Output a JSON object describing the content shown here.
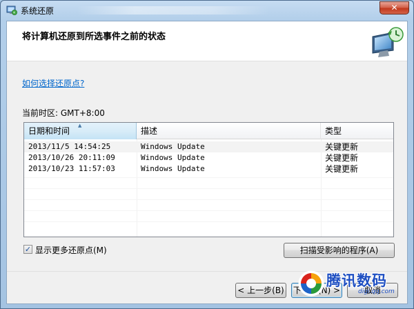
{
  "window": {
    "title": "系统还原",
    "close_label": "✕",
    "accent_close": "#c2391d"
  },
  "header": {
    "title": "将计算机还原到所选事件之前的状态",
    "art_icon": "system-restore-monitor-icon"
  },
  "help_link": "如何选择还原点?",
  "timezone_label": "当前时区: GMT+8:00",
  "table": {
    "columns": [
      "日期和时间",
      "描述",
      "类型"
    ],
    "sorted_column": "日期和时间",
    "rows": [
      {
        "date": "2013/11/5 14:54:25",
        "description": "Windows Update",
        "type": "关键更新"
      },
      {
        "date": "2013/10/26 20:11:09",
        "description": "Windows Update",
        "type": "关键更新"
      },
      {
        "date": "2013/10/23 11:57:03",
        "description": "Windows Update",
        "type": "关键更新"
      }
    ]
  },
  "show_more": {
    "label": "显示更多还原点(M)",
    "checked": true
  },
  "buttons": {
    "scan": "扫描受影响的程序(A)",
    "prev": "< 上一步(B)",
    "next": "下一步(N) >",
    "cancel": "取消"
  },
  "watermark": {
    "text": "腾讯数码",
    "sub": "digi.qq.com"
  }
}
